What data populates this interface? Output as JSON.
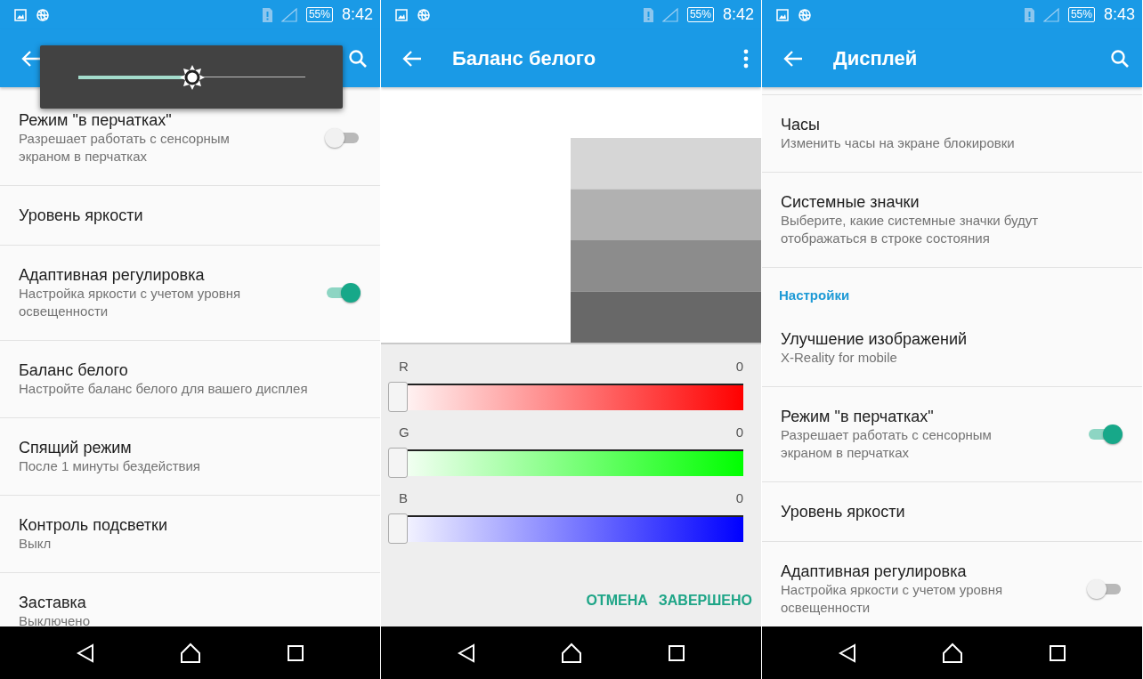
{
  "screens": [
    {
      "kind": "settings",
      "status_bar": {
        "battery": "55%",
        "time": "8:42"
      },
      "app_bar": {
        "action": {
          "kind": "search"
        }
      },
      "brightness_popup": {
        "level": 0.5
      },
      "items": [
        {
          "kind": "setting",
          "title": "Режим \"в перчатках\"",
          "summary": "Разрешает работать с сенсорным экраном в перчатках",
          "on": false
        },
        {
          "kind": "setting",
          "title": "Уровень яркости"
        },
        {
          "kind": "setting",
          "title": "Адаптивная регулировка",
          "summary": "Настройка яркости с учетом уровня освещенности",
          "on": true
        },
        {
          "kind": "setting",
          "title": "Баланс белого",
          "summary": "Настройте баланс белого для вашего дисплея"
        },
        {
          "kind": "setting",
          "title": "Спящий режим",
          "summary": "После 1 минуты бездействия"
        },
        {
          "kind": "setting",
          "title": "Контроль подсветки",
          "summary": "Выкл"
        },
        {
          "kind": "setting",
          "title": "Заставка",
          "summary": "Выключено"
        }
      ]
    },
    {
      "kind": "white_balance",
      "status_bar": {
        "battery": "55%",
        "time": "8:42"
      },
      "app_bar": {
        "title": "Баланс белого",
        "action": {
          "kind": "more"
        }
      },
      "sliders": [
        {
          "label": "R",
          "value": "0",
          "level": 0,
          "color": "#ff0000"
        },
        {
          "label": "G",
          "value": "0",
          "level": 0,
          "color": "#00ff00"
        },
        {
          "label": "B",
          "value": "0",
          "level": 0,
          "color": "#0000ff"
        }
      ],
      "buttons": [
        "ОТМЕНА",
        "ЗАВЕРШЕНО"
      ]
    },
    {
      "kind": "settings",
      "status_bar": {
        "battery": "55%",
        "time": "8:43"
      },
      "app_bar": {
        "title": "Дисплей",
        "action": {
          "kind": "search"
        }
      },
      "scrolled": true,
      "items": [
        {
          "kind": "setting",
          "title": "Часы",
          "summary": "Изменить часы на экране блокировки"
        },
        {
          "kind": "setting",
          "title": "Системные значки",
          "summary": "Выберите, какие системные значки будут отображаться в строке состояния"
        },
        {
          "kind": "header",
          "title": "Настройки"
        },
        {
          "kind": "setting",
          "title": "Улучшение изображений",
          "summary": "X-Reality for mobile"
        },
        {
          "kind": "setting",
          "title": "Режим \"в перчатках\"",
          "summary": "Разрешает работать с сенсорным экраном в перчатках",
          "on": true
        },
        {
          "kind": "setting",
          "title": "Уровень яркости"
        },
        {
          "kind": "setting",
          "title": "Адаптивная регулировка",
          "summary": "Настройка яркости с учетом уровня освещенности",
          "on": false
        }
      ]
    }
  ]
}
